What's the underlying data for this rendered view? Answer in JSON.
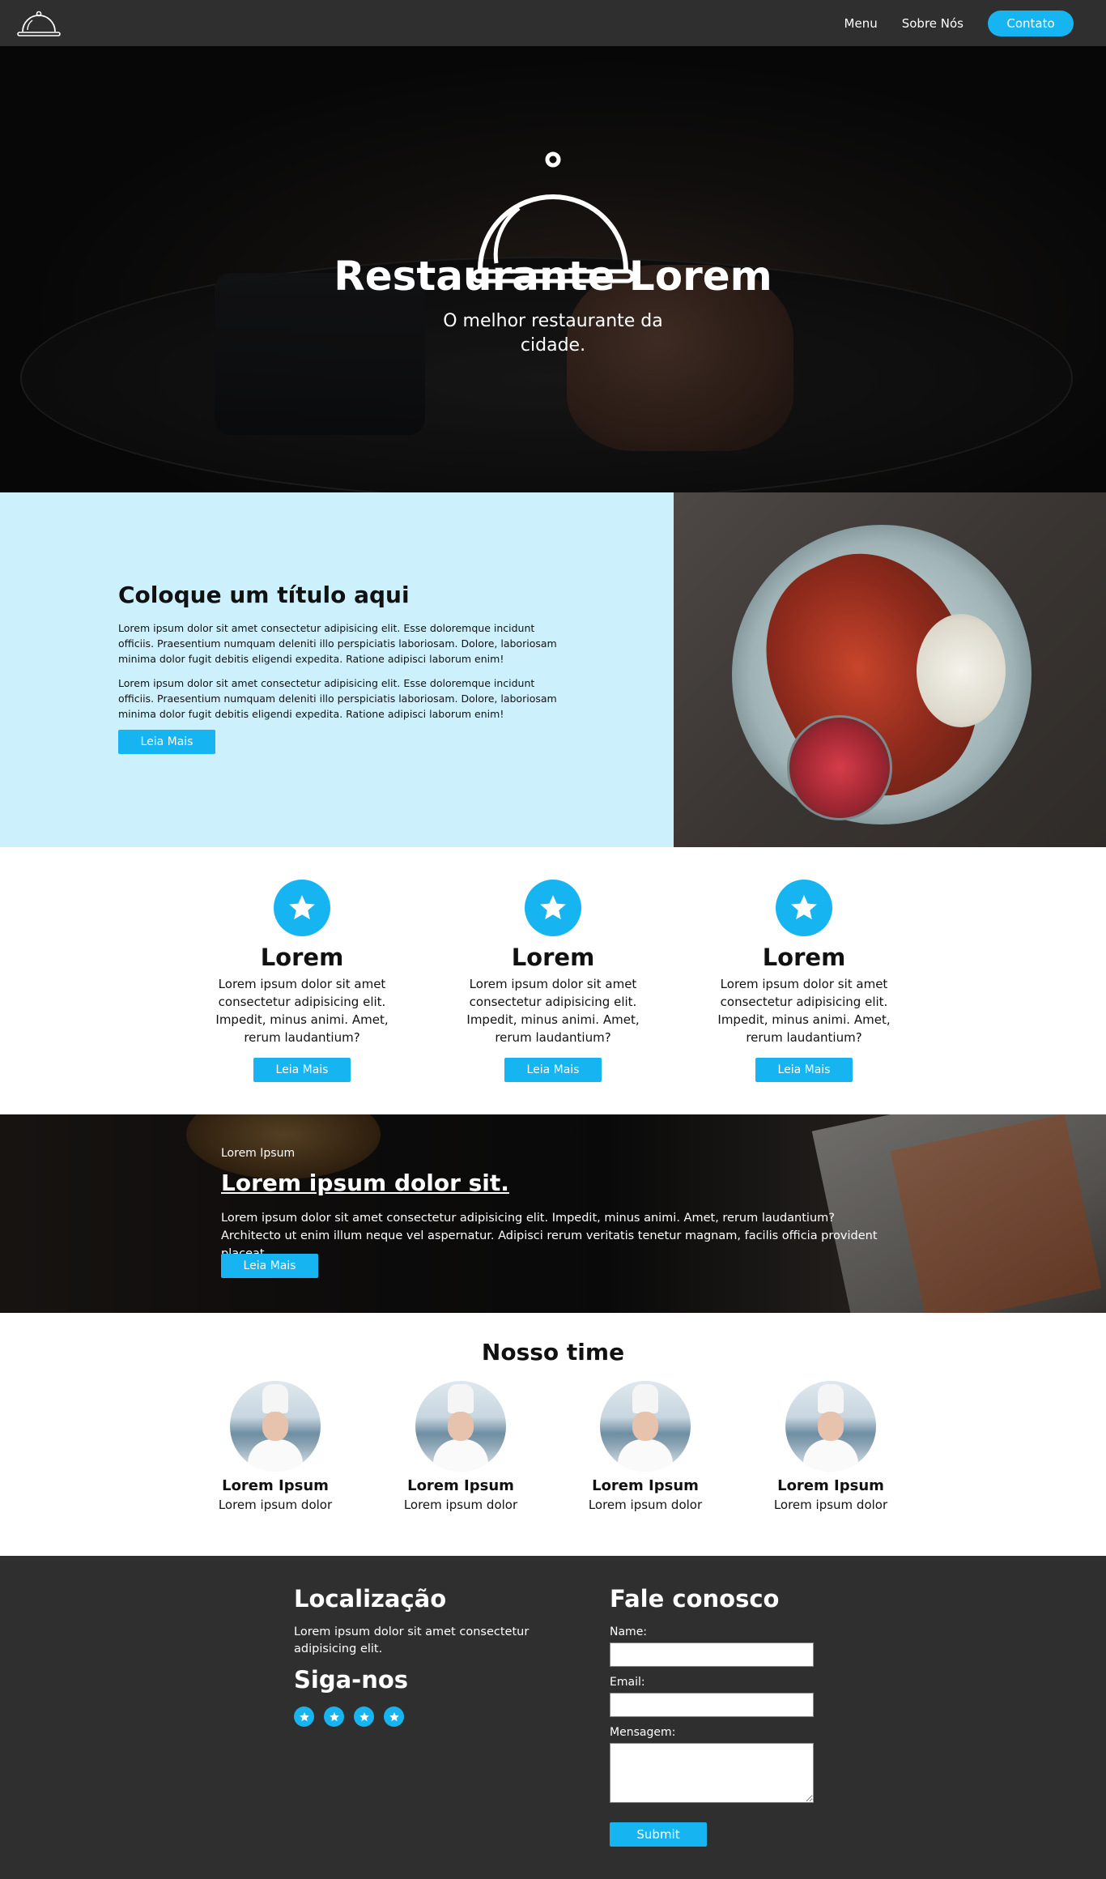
{
  "colors": {
    "accent": "#16b4f0",
    "nav_bg": "#2f2f2f",
    "about_bg": "#cdf0fd",
    "footer_bg": "#2f2f2f"
  },
  "nav": {
    "logo_icon": "cloche-icon",
    "links": [
      "Menu",
      "Sobre Nós"
    ],
    "contact_label": "Contato"
  },
  "hero": {
    "icon": "cloche-icon",
    "title": "Restaurante Lorem",
    "subtitle": "O melhor restaurante da cidade."
  },
  "about": {
    "title": "Coloque um título aqui",
    "paragraphs": [
      "Lorem ipsum dolor sit amet consectetur adipisicing elit. Esse doloremque incidunt officiis. Praesentium numquam deleniti illo perspiciatis laboriosam. Dolore, laboriosam minima dolor fugit debitis eligendi expedita. Ratione adipisci laborum enim!",
      "Lorem ipsum dolor sit amet consectetur adipisicing elit. Esse doloremque incidunt officiis. Praesentium numquam deleniti illo perspiciatis laboriosam. Dolore, laboriosam minima dolor fugit debitis eligendi expedita. Ratione adipisci laborum enim!"
    ],
    "button_label": "Leia Mais"
  },
  "features": [
    {
      "icon": "star-icon",
      "title": "Lorem",
      "text": "Lorem ipsum dolor sit amet consectetur adipisicing elit. Impedit, minus animi. Amet, rerum laudantium?",
      "button_label": "Leia Mais"
    },
    {
      "icon": "star-icon",
      "title": "Lorem",
      "text": "Lorem ipsum dolor sit amet consectetur adipisicing elit. Impedit, minus animi. Amet, rerum laudantium?",
      "button_label": "Leia Mais"
    },
    {
      "icon": "star-icon",
      "title": "Lorem",
      "text": "Lorem ipsum dolor sit amet consectetur adipisicing elit. Impedit, minus animi. Amet, rerum laudantium?",
      "button_label": "Leia Mais"
    }
  ],
  "banner": {
    "eyebrow": "Lorem Ipsum",
    "title": "Lorem ipsum dolor sit.",
    "text": "Lorem ipsum dolor sit amet consectetur adipisicing elit. Impedit, minus animi. Amet, rerum laudantium? Architecto ut enim illum neque vel aspernatur. Adipisci rerum veritatis tenetur magnam, facilis officia provident placeat.",
    "button_label": "Leia Mais"
  },
  "team": {
    "title": "Nosso time",
    "members": [
      {
        "name": "Lorem Ipsum",
        "role": "Lorem ipsum dolor"
      },
      {
        "name": "Lorem Ipsum",
        "role": "Lorem ipsum dolor"
      },
      {
        "name": "Lorem Ipsum",
        "role": "Lorem ipsum dolor"
      },
      {
        "name": "Lorem Ipsum",
        "role": "Lorem ipsum dolor"
      }
    ]
  },
  "footer": {
    "location_title": "Localização",
    "location_text": "Lorem ipsum dolor sit amet consectetur adipisicing elit.",
    "follow_title": "Siga-nos",
    "social_icons": [
      "star-icon",
      "star-icon",
      "star-icon",
      "star-icon"
    ],
    "contact_title": "Fale conosco",
    "name_label": "Name:",
    "name_value": "",
    "email_label": "Email:",
    "email_value": "",
    "message_label": "Mensagem:",
    "message_value": "",
    "submit_label": "Submit"
  }
}
